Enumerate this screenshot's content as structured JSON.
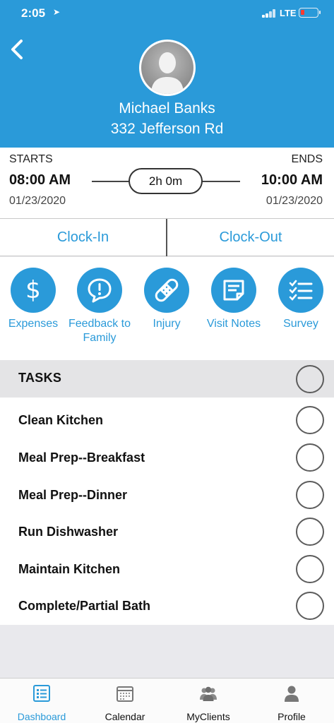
{
  "status_bar": {
    "time": "2:05",
    "network": "LTE"
  },
  "header": {
    "client_name": "Michael Banks",
    "client_address": "332 Jefferson Rd"
  },
  "schedule": {
    "starts_label": "STARTS",
    "ends_label": "ENDS",
    "start_time": "08:00 AM",
    "end_time": "10:00 AM",
    "start_date": "01/23/2020",
    "end_date": "01/23/2020",
    "duration": "2h 0m"
  },
  "clock": {
    "clock_in_label": "Clock-In",
    "clock_out_label": "Clock-Out"
  },
  "actions": [
    {
      "label": "Expenses",
      "icon": "dollar-icon"
    },
    {
      "label": "Feedback to Family",
      "icon": "feedback-icon"
    },
    {
      "label": "Injury",
      "icon": "bandage-icon"
    },
    {
      "label": "Visit Notes",
      "icon": "notes-icon"
    },
    {
      "label": "Survey",
      "icon": "checklist-icon"
    }
  ],
  "tasks": {
    "title": "TASKS",
    "items": [
      {
        "label": "Clean Kitchen"
      },
      {
        "label": "Meal Prep--Breakfast"
      },
      {
        "label": "Meal Prep--Dinner"
      },
      {
        "label": "Run Dishwasher"
      },
      {
        "label": "Maintain Kitchen"
      },
      {
        "label": "Complete/Partial Bath"
      }
    ]
  },
  "tabbar": {
    "active": "Dashboard",
    "items": [
      {
        "label": "Dashboard",
        "icon": "dashboard-icon"
      },
      {
        "label": "Calendar",
        "icon": "calendar-icon"
      },
      {
        "label": "MyClients",
        "icon": "clients-icon"
      },
      {
        "label": "Profile",
        "icon": "profile-icon"
      }
    ]
  },
  "colors": {
    "accent": "#2a9ad9",
    "battery_low": "#ff3b30"
  }
}
